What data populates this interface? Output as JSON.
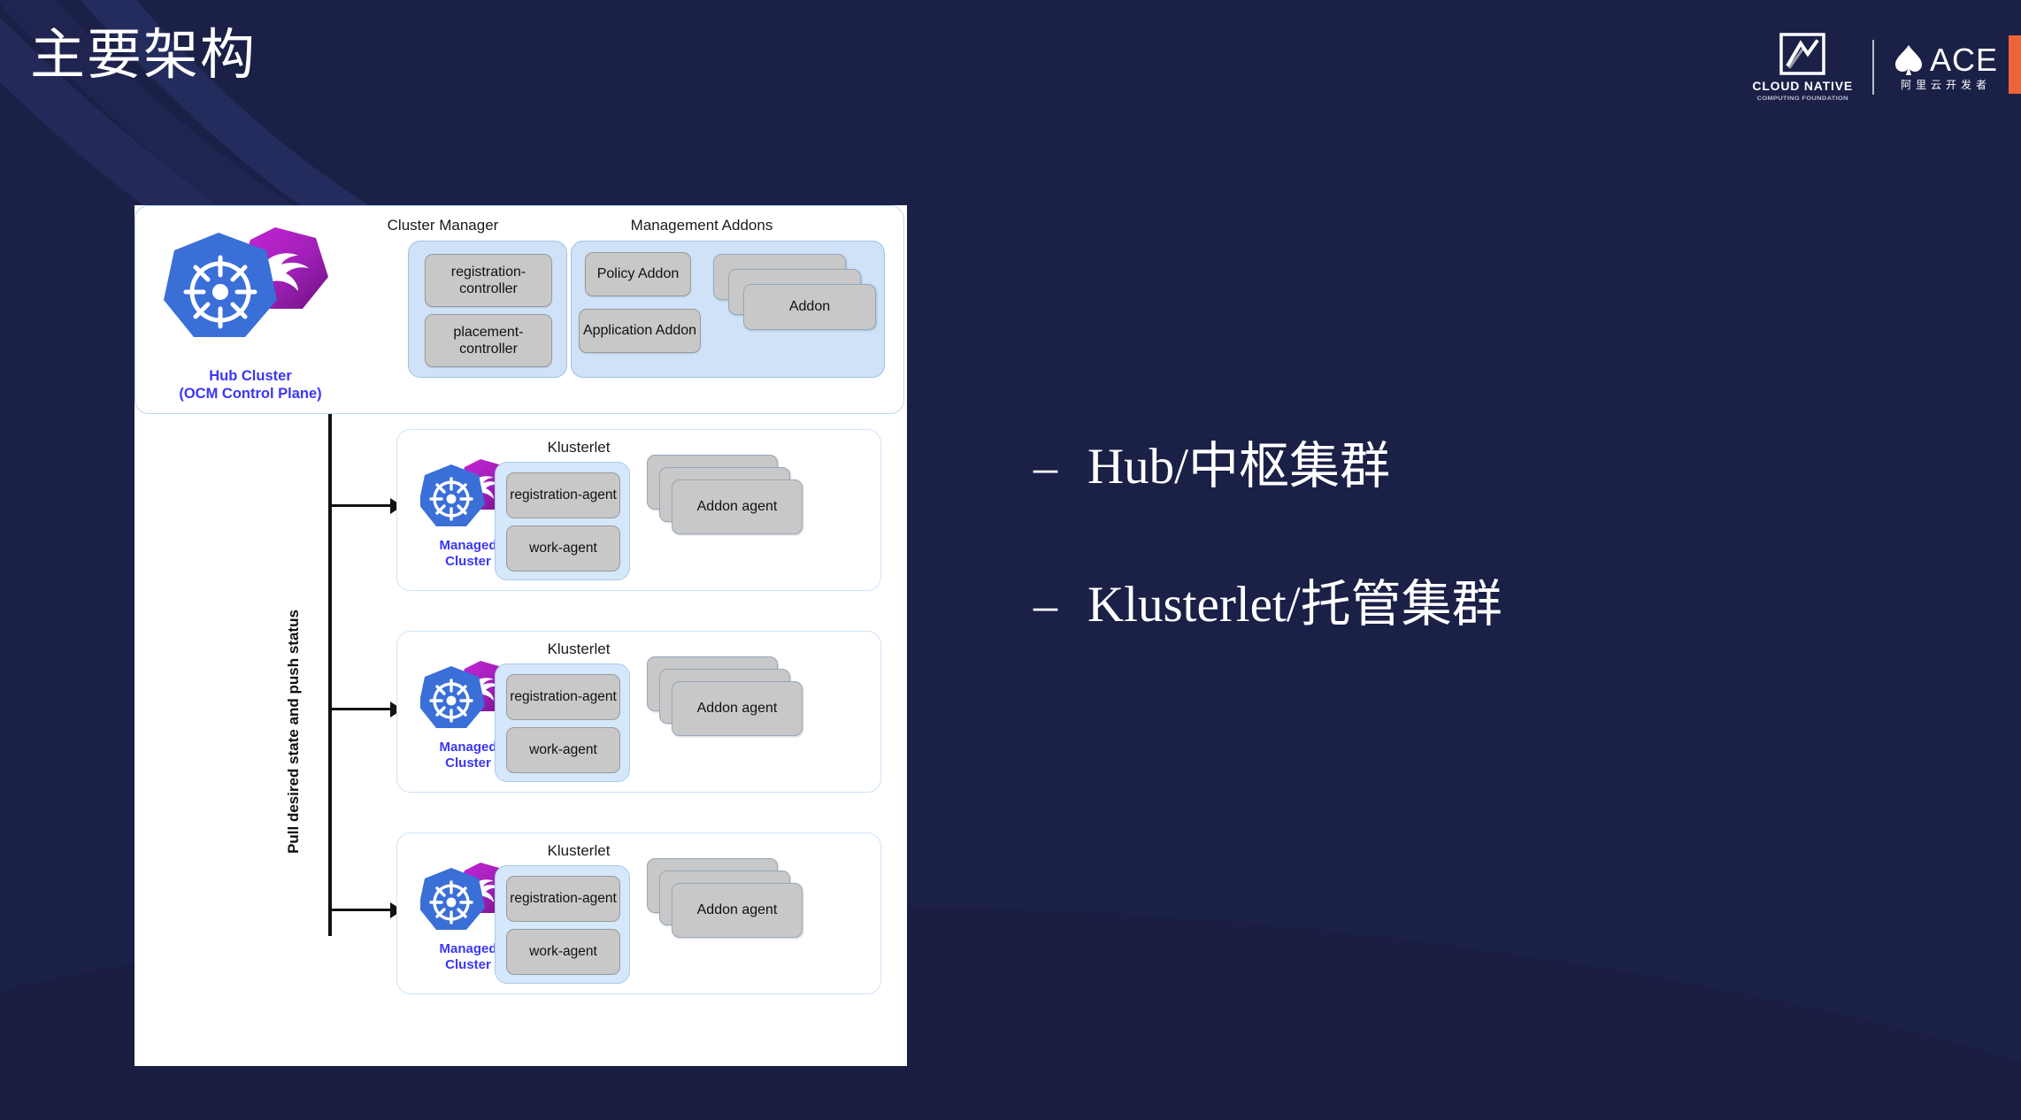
{
  "slide": {
    "title": "主要架构",
    "background_color": "#1b2047",
    "accent_color": "#ec6437"
  },
  "header": {
    "cncf_logo": {
      "name": "cncf-logo",
      "line1": "CLOUD NATIVE",
      "line2": "COMPUTING FOUNDATION"
    },
    "ace_logo": {
      "name": "ace-logo",
      "wordmark": "ACE",
      "subtitle": "阿里云开发者"
    }
  },
  "diagram": {
    "hub": {
      "label_line1": "Hub Cluster",
      "label_line2": "(OCM Control Plane)",
      "label_color": "#3b37f5",
      "cluster_manager": {
        "title": "Cluster Manager",
        "components": [
          "registration-controller",
          "placement-controller"
        ],
        "component_lines": [
          [
            "registration-",
            "controller"
          ],
          [
            "placement-",
            "controller"
          ]
        ]
      },
      "management_addons": {
        "title": "Management Addons",
        "items": [
          "Policy Addon",
          "Application Addon"
        ],
        "stack_label": "Addon",
        "stack_count": 3
      }
    },
    "connector_label": "Pull desired state and push status",
    "managed_clusters": [
      {
        "label_line1": "Managed",
        "label_line2": "Cluster",
        "klusterlet_title": "Klusterlet",
        "agents": [
          "registration-agent",
          "work-agent"
        ],
        "addon_stack_label": "Addon agent",
        "addon_stack_count": 3
      },
      {
        "label_line1": "Managed",
        "label_line2": "Cluster",
        "klusterlet_title": "Klusterlet",
        "agents": [
          "registration-agent",
          "work-agent"
        ],
        "addon_stack_label": "Addon agent",
        "addon_stack_count": 3
      },
      {
        "label_line1": "Managed",
        "label_line2": "Cluster",
        "klusterlet_title": "Klusterlet",
        "agents": [
          "registration-agent",
          "work-agent"
        ],
        "addon_stack_label": "Addon agent",
        "addon_stack_count": 3
      }
    ]
  },
  "bullets": [
    {
      "dash": "–",
      "text": "Hub/中枢集群"
    },
    {
      "dash": "–",
      "text": "Klusterlet/托管集群"
    }
  ]
}
